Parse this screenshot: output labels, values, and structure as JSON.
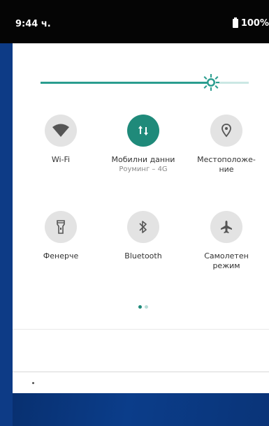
{
  "status_bar": {
    "time": "9:44 ч.",
    "battery": "100%"
  },
  "brightness": {
    "level": 0.82
  },
  "tiles": [
    {
      "label": "Wi-Fi",
      "sub": "",
      "icon": "wifi-icon",
      "active": false
    },
    {
      "label": "Мобилни данни",
      "sub": "Роуминг – 4G",
      "icon": "mobile-data-icon",
      "active": true
    },
    {
      "label": "Местоположе-\nние",
      "sub": "",
      "icon": "location-icon",
      "active": false
    },
    {
      "label": "Фенерче",
      "sub": "",
      "icon": "flashlight-icon",
      "active": false
    },
    {
      "label": "Bluetooth",
      "sub": "",
      "icon": "bluetooth-icon",
      "active": false
    },
    {
      "label": "Самолетен\nрежим",
      "sub": "",
      "icon": "airplane-icon",
      "active": false
    }
  ],
  "pager": {
    "pages": 2,
    "current": 0
  },
  "colors": {
    "accent": "#1f8a7a",
    "status_bar": "#050505",
    "tile_bg": "#e3e3e3"
  }
}
